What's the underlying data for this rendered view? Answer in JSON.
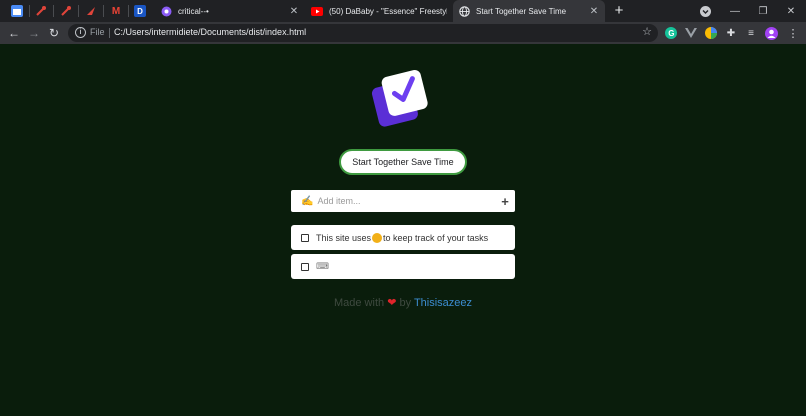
{
  "browser": {
    "tabs": [
      {
        "title": "critical--•",
        "active": false
      },
      {
        "title": "(50) DaBaby - \"Essence\" Freestyle",
        "active": false
      },
      {
        "title": "Start Together Save Time",
        "active": true
      }
    ],
    "pinned_letters": {
      "gmail": "M",
      "d": "D"
    },
    "address": {
      "scheme_label": "File",
      "url": "C:/Users/intermidiete/Documents/dist/index.html"
    }
  },
  "page": {
    "button_label": "Start Together Save Time",
    "add_item": {
      "placeholder": "Add item..."
    },
    "tasks": [
      {
        "text_before": "This site uses ",
        "text_after": "to keep track of your tasks"
      },
      {
        "text": "⌨"
      }
    ],
    "footer": {
      "made_with": "Made with ",
      "by": " by ",
      "author": "Thisisazeez"
    }
  },
  "colors": {
    "accent_green": "#3f9a40",
    "page_bg": "#0a1d0c",
    "link": "#3c8dd1"
  }
}
